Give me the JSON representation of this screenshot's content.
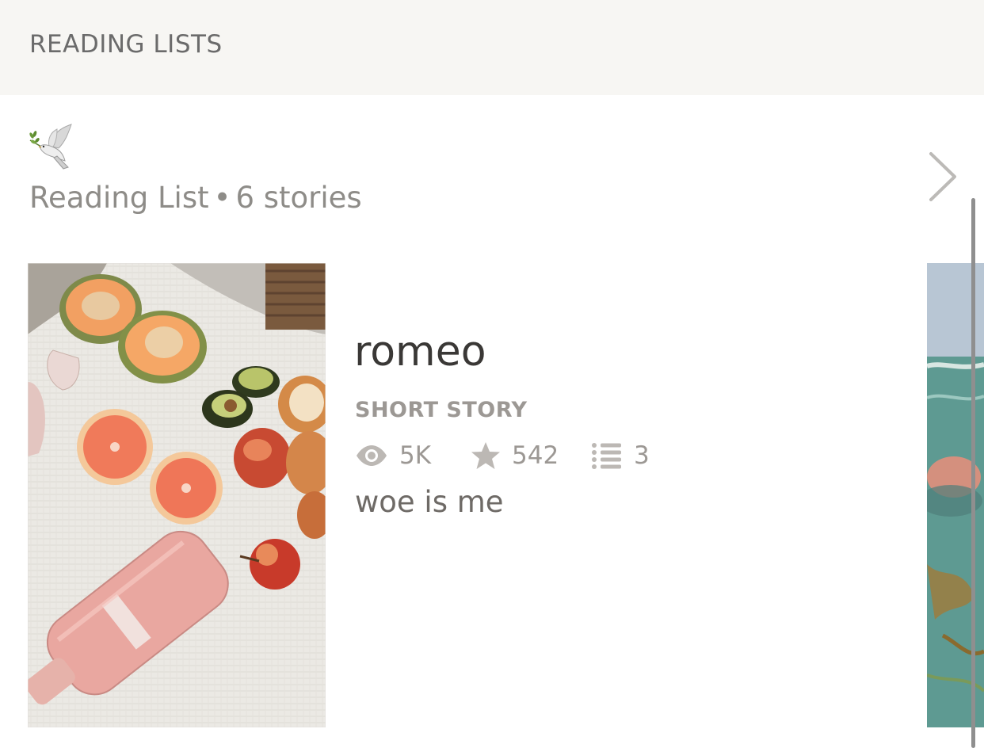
{
  "header": {
    "title": "READING LISTS"
  },
  "reading_list": {
    "icon": "dove-icon",
    "label": "Reading List",
    "separator": "•",
    "count_text": "6 stories"
  },
  "story": {
    "title": "romeo",
    "type": "SHORT STORY",
    "stats": {
      "views": "5K",
      "votes": "542",
      "parts": "3"
    },
    "description": "woe is me"
  },
  "colors": {
    "header_bg": "#f7f6f3",
    "meta_text": "#8e8c88",
    "title_text": "#3a3836"
  }
}
